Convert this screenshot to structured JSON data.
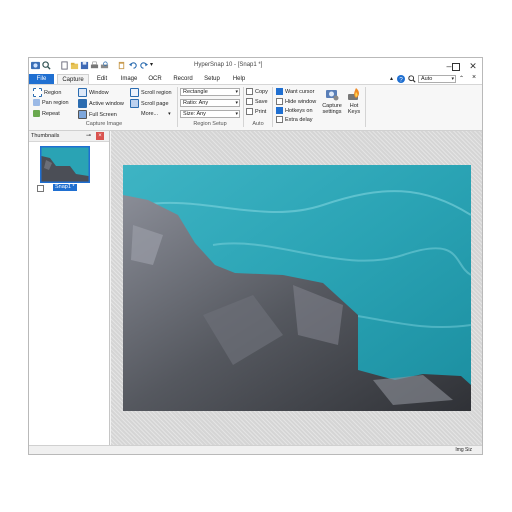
{
  "window": {
    "title": "HyperSnap 10 - [Snap1 *]"
  },
  "menu": {
    "tabs": [
      "File",
      "Capture",
      "Edit",
      "Image",
      "OCR",
      "Record",
      "Setup",
      "Help"
    ],
    "active_tab": "Capture",
    "zoom_value": "Auto"
  },
  "ribbon": {
    "capture_image": {
      "label": "Capture Image",
      "col1": [
        "Region",
        "Pan region",
        "Repeat"
      ],
      "col2": [
        "Window",
        "Active window",
        "Full Screen"
      ],
      "col3": [
        "Scroll region",
        "Scroll page",
        "More..."
      ]
    },
    "region_setup": {
      "label": "Region Setup",
      "shape": "Rectangle",
      "ratio": "Ratio: Any",
      "size": "Size: Any"
    },
    "auto": {
      "label": "Auto",
      "copy": "Copy",
      "save": "Save",
      "print": "Print"
    },
    "options": {
      "want_cursor": "Want cursor",
      "hide_window": "Hide window",
      "hotkeys_on": "Hotkeys on",
      "extra_delay": "Extra delay",
      "want_cursor_checked": true,
      "hide_window_checked": false,
      "hotkeys_on_checked": true,
      "extra_delay_checked": false
    },
    "capture_settings": {
      "line1": "Capture",
      "line2": "settings"
    },
    "hot_keys": {
      "line1": "Hot",
      "line2": "Keys"
    }
  },
  "thumbnails": {
    "title": "Thumbnails",
    "items": [
      {
        "label": "Snap1 *"
      }
    ]
  },
  "status": {
    "text": "Img Siz"
  },
  "colors": {
    "accent": "#1f6fd1",
    "water": "#2aa3b4",
    "rock": "#4a4a50"
  }
}
